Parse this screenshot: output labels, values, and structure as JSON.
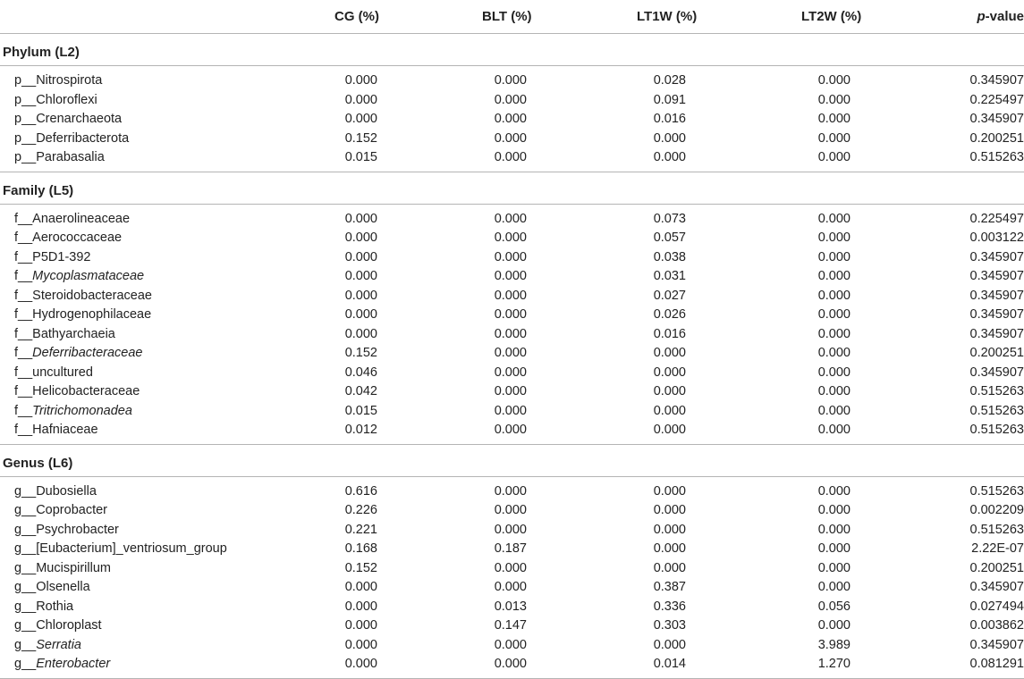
{
  "header": {
    "cg": "CG (%)",
    "blt": "BLT (%)",
    "lt1w": "LT1W (%)",
    "lt2w": "LT2W (%)",
    "p_italic": "p",
    "p_rest": "-value"
  },
  "sections": [
    {
      "title": "Phylum (L2)",
      "rows": [
        {
          "prefix": "p__",
          "name": "Nitrospirota",
          "italic": false,
          "cg": "0.000",
          "blt": "0.000",
          "lt1w": "0.028",
          "lt2w": "0.000",
          "p": "0.345907"
        },
        {
          "prefix": "p__",
          "name": "Chloroflexi",
          "italic": false,
          "cg": "0.000",
          "blt": "0.000",
          "lt1w": "0.091",
          "lt2w": "0.000",
          "p": "0.225497"
        },
        {
          "prefix": "p__",
          "name": "Crenarchaeota",
          "italic": false,
          "cg": "0.000",
          "blt": "0.000",
          "lt1w": "0.016",
          "lt2w": "0.000",
          "p": "0.345907"
        },
        {
          "prefix": "p__",
          "name": "Deferribacterota",
          "italic": false,
          "cg": "0.152",
          "blt": "0.000",
          "lt1w": "0.000",
          "lt2w": "0.000",
          "p": "0.200251"
        },
        {
          "prefix": "p__",
          "name": "Parabasalia",
          "italic": false,
          "cg": "0.015",
          "blt": "0.000",
          "lt1w": "0.000",
          "lt2w": "0.000",
          "p": "0.515263"
        }
      ]
    },
    {
      "title": "Family (L5)",
      "rows": [
        {
          "prefix": "f__",
          "name": "Anaerolineaceae",
          "italic": false,
          "cg": "0.000",
          "blt": "0.000",
          "lt1w": "0.073",
          "lt2w": "0.000",
          "p": "0.225497"
        },
        {
          "prefix": "f__",
          "name": "Aerococcaceae",
          "italic": false,
          "cg": "0.000",
          "blt": "0.000",
          "lt1w": "0.057",
          "lt2w": "0.000",
          "p": "0.003122"
        },
        {
          "prefix": "f__",
          "name": "P5D1-392",
          "italic": false,
          "cg": "0.000",
          "blt": "0.000",
          "lt1w": "0.038",
          "lt2w": "0.000",
          "p": "0.345907"
        },
        {
          "prefix": "f__",
          "name": "Mycoplasmataceae",
          "italic": true,
          "cg": "0.000",
          "blt": "0.000",
          "lt1w": "0.031",
          "lt2w": "0.000",
          "p": "0.345907"
        },
        {
          "prefix": "f__",
          "name": "Steroidobacteraceae",
          "italic": false,
          "cg": "0.000",
          "blt": "0.000",
          "lt1w": "0.027",
          "lt2w": "0.000",
          "p": "0.345907"
        },
        {
          "prefix": "f__",
          "name": "Hydrogenophilaceae",
          "italic": false,
          "cg": "0.000",
          "blt": "0.000",
          "lt1w": "0.026",
          "lt2w": "0.000",
          "p": "0.345907"
        },
        {
          "prefix": "f__",
          "name": "Bathyarchaeia",
          "italic": false,
          "cg": "0.000",
          "blt": "0.000",
          "lt1w": "0.016",
          "lt2w": "0.000",
          "p": "0.345907"
        },
        {
          "prefix": "f__",
          "name": "Deferribacteraceae",
          "italic": true,
          "cg": "0.152",
          "blt": "0.000",
          "lt1w": "0.000",
          "lt2w": "0.000",
          "p": "0.200251"
        },
        {
          "prefix": "f__",
          "name": "uncultured",
          "italic": false,
          "cg": "0.046",
          "blt": "0.000",
          "lt1w": "0.000",
          "lt2w": "0.000",
          "p": "0.345907"
        },
        {
          "prefix": "f__",
          "name": "Helicobacteraceae",
          "italic": false,
          "cg": "0.042",
          "blt": "0.000",
          "lt1w": "0.000",
          "lt2w": "0.000",
          "p": "0.515263"
        },
        {
          "prefix": "f__",
          "name": "Tritrichomonadea",
          "italic": true,
          "cg": "0.015",
          "blt": "0.000",
          "lt1w": "0.000",
          "lt2w": "0.000",
          "p": "0.515263"
        },
        {
          "prefix": "f__",
          "name": "Hafniaceae",
          "italic": false,
          "cg": "0.012",
          "blt": "0.000",
          "lt1w": "0.000",
          "lt2w": "0.000",
          "p": "0.515263"
        }
      ]
    },
    {
      "title": "Genus (L6)",
      "rows": [
        {
          "prefix": "g__",
          "name": "Dubosiella",
          "italic": false,
          "cg": "0.616",
          "blt": "0.000",
          "lt1w": "0.000",
          "lt2w": "0.000",
          "p": "0.515263"
        },
        {
          "prefix": "g__",
          "name": "Coprobacter",
          "italic": false,
          "cg": "0.226",
          "blt": "0.000",
          "lt1w": "0.000",
          "lt2w": "0.000",
          "p": "0.002209"
        },
        {
          "prefix": "g__",
          "name": "Psychrobacter",
          "italic": false,
          "cg": "0.221",
          "blt": "0.000",
          "lt1w": "0.000",
          "lt2w": "0.000",
          "p": "0.515263"
        },
        {
          "prefix": "g__",
          "name": "[Eubacterium]_ventriosum_group",
          "italic": false,
          "cg": "0.168",
          "blt": "0.187",
          "lt1w": "0.000",
          "lt2w": "0.000",
          "p": "2.22E-07"
        },
        {
          "prefix": "g__",
          "name": "Mucispirillum",
          "italic": false,
          "cg": "0.152",
          "blt": "0.000",
          "lt1w": "0.000",
          "lt2w": "0.000",
          "p": "0.200251"
        },
        {
          "prefix": "g__",
          "name": "Olsenella",
          "italic": false,
          "cg": "0.000",
          "blt": "0.000",
          "lt1w": "0.387",
          "lt2w": "0.000",
          "p": "0.345907"
        },
        {
          "prefix": "g__",
          "name": "Rothia",
          "italic": false,
          "cg": "0.000",
          "blt": "0.013",
          "lt1w": "0.336",
          "lt2w": "0.056",
          "p": "0.027494"
        },
        {
          "prefix": "g__",
          "name": "Chloroplast",
          "italic": false,
          "cg": "0.000",
          "blt": "0.147",
          "lt1w": "0.303",
          "lt2w": "0.000",
          "p": "0.003862"
        },
        {
          "prefix": "g__",
          "name": "Serratia",
          "italic": true,
          "cg": "0.000",
          "blt": "0.000",
          "lt1w": "0.000",
          "lt2w": "3.989",
          "p": "0.345907"
        },
        {
          "prefix": "g__",
          "name": "Enterobacter",
          "italic": true,
          "cg": "0.000",
          "blt": "0.000",
          "lt1w": "0.014",
          "lt2w": "1.270",
          "p": "0.081291"
        }
      ]
    }
  ]
}
